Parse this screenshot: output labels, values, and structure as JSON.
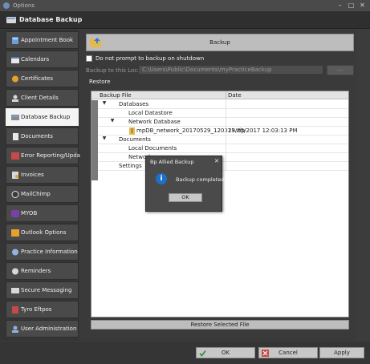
{
  "window": {
    "title": "Options"
  },
  "header": {
    "title": "Database Backup"
  },
  "sidebar": {
    "items": [
      {
        "label": "Appointment Book",
        "icon": "calendar-book-icon"
      },
      {
        "label": "Calendars",
        "icon": "calendar-icon"
      },
      {
        "label": "Certificates",
        "icon": "certificate-icon"
      },
      {
        "label": "Client Details",
        "icon": "client-icon"
      },
      {
        "label": "Database Backup",
        "icon": "database-backup-icon"
      },
      {
        "label": "Documents",
        "icon": "documents-icon"
      },
      {
        "label": "Error Reporting/Updates",
        "icon": "error-reporting-icon"
      },
      {
        "label": "Invoices",
        "icon": "invoices-icon"
      },
      {
        "label": "MailChimp",
        "icon": "mailchimp-icon"
      },
      {
        "label": "MYOB",
        "icon": "myob-icon"
      },
      {
        "label": "Outlook Options",
        "icon": "outlook-icon"
      },
      {
        "label": "Practice Information",
        "icon": "practice-icon"
      },
      {
        "label": "Reminders",
        "icon": "reminders-icon"
      },
      {
        "label": "Secure Messaging",
        "icon": "secure-messaging-icon"
      },
      {
        "label": "Tyro Eftpos",
        "icon": "tyro-icon"
      },
      {
        "label": "User Administration",
        "icon": "user-admin-icon"
      }
    ],
    "active_index": 4
  },
  "main": {
    "backup_button": "Backup",
    "no_prompt_label": "Do not prompt to backup on shutdown",
    "location_label": "Backup to this Location :",
    "location_value": "C:\\Users\\Public\\Documents\\myPracticeBackup",
    "browse_label": "...",
    "restore_label": "Restore",
    "grid": {
      "col_file": "Backup File",
      "col_date": "Date",
      "rows": [
        {
          "text": "Databases",
          "date": ""
        },
        {
          "text": "Local Datastore",
          "date": ""
        },
        {
          "text": "Network Database",
          "date": ""
        },
        {
          "text": "mpDB_network_20170529_120313.zip",
          "date": "29/05/2017 12:03:13 PM"
        },
        {
          "text": "Documents",
          "date": ""
        },
        {
          "text": "Local Documents",
          "date": ""
        },
        {
          "text": "Network",
          "date": ""
        },
        {
          "text": "Settings",
          "date": ""
        }
      ]
    },
    "restore_selected": "Restore Selected File"
  },
  "footer": {
    "ok": "OK",
    "cancel": "Cancel",
    "apply": "Apply"
  },
  "dialog": {
    "title": "Bp Allied Backup",
    "message": "Backup completed",
    "ok": "OK",
    "icon": "info-icon"
  },
  "colors": {
    "background": "#3c3c3c",
    "sidebar_active": "#f4f4f4",
    "dialog_info": "#1f6fc7"
  }
}
